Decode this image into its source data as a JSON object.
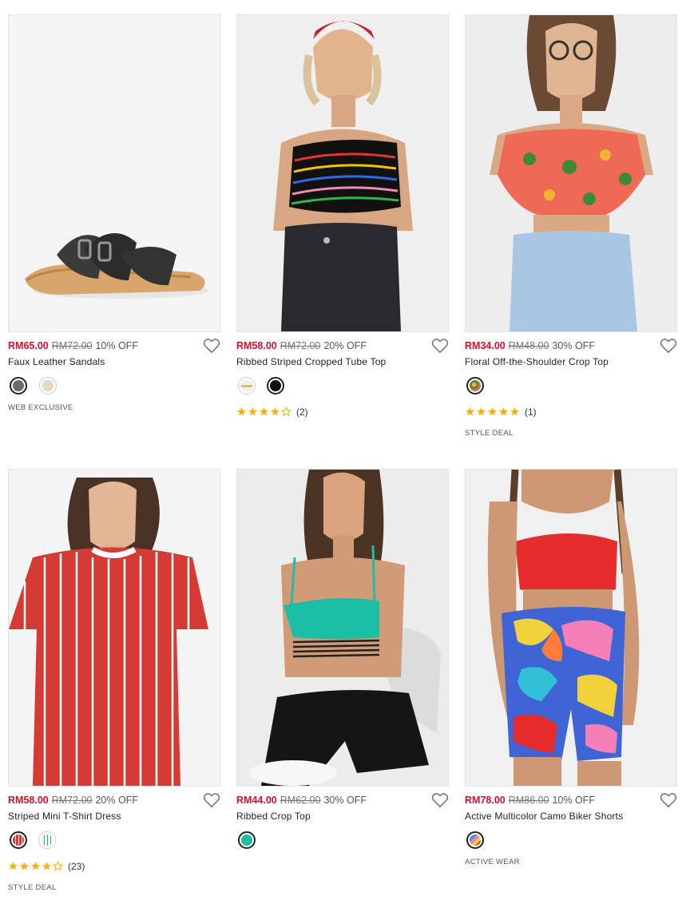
{
  "products": [
    {
      "name": "Faux Leather Sandals",
      "price": "RM65.00",
      "original_price": "RM72.00",
      "discount": "10% OFF",
      "image": "sandals-photo",
      "swatches": [
        {
          "color": "#6b6b6b",
          "selected": true
        },
        {
          "color": "#e6d8c8",
          "selected": false
        }
      ],
      "rating": null,
      "rating_count": "",
      "tag": "WEB EXCLUSIVE"
    },
    {
      "name": "Ribbed Striped Cropped Tube Top",
      "price": "RM58.00",
      "original_price": "RM72.00",
      "discount": "20% OFF",
      "image": "tube-top-photo",
      "swatches": [
        {
          "color": "#f2efe7",
          "selected": false
        },
        {
          "color": "#111111",
          "selected": true
        }
      ],
      "rating": 4,
      "rating_count": "(2)",
      "tag": ""
    },
    {
      "name": "Floral Off-the-Shoulder Crop Top",
      "price": "RM34.00",
      "original_price": "RM48.00",
      "discount": "30% OFF",
      "image": "floral-top-photo",
      "swatches": [
        {
          "color": "#e86a52",
          "selected": true
        }
      ],
      "rating": 5,
      "rating_count": "(1)",
      "tag": "STYLE DEAL"
    },
    {
      "name": "Striped Mini T-Shirt Dress",
      "price": "RM58.00",
      "original_price": "RM72.00",
      "discount": "20% OFF",
      "image": "striped-dress-photo",
      "swatches": [
        {
          "color": "#d63a34",
          "selected": true
        },
        {
          "color": "#e8f1f4",
          "selected": false
        }
      ],
      "rating": 4,
      "rating_count": "(23)",
      "tag": "STYLE DEAL"
    },
    {
      "name": "Ribbed Crop Top",
      "price": "RM44.00",
      "original_price": "RM62.00",
      "discount": "30% OFF",
      "image": "crop-top-photo",
      "swatches": [
        {
          "color": "#1bbfa5",
          "selected": true
        }
      ],
      "rating": null,
      "rating_count": "",
      "tag": ""
    },
    {
      "name": "Active Multicolor Camo Biker Shorts",
      "price": "RM78.00",
      "original_price": "RM86.00",
      "discount": "10% OFF",
      "image": "biker-shorts-photo",
      "swatches": [
        {
          "color": "#4a8de0",
          "selected": true
        }
      ],
      "rating": null,
      "rating_count": "",
      "tag": "ACTIVE WEAR"
    }
  ],
  "colors": {
    "sale": "#d0112b",
    "star": "#f5b301",
    "border": "#e4e4e4"
  }
}
